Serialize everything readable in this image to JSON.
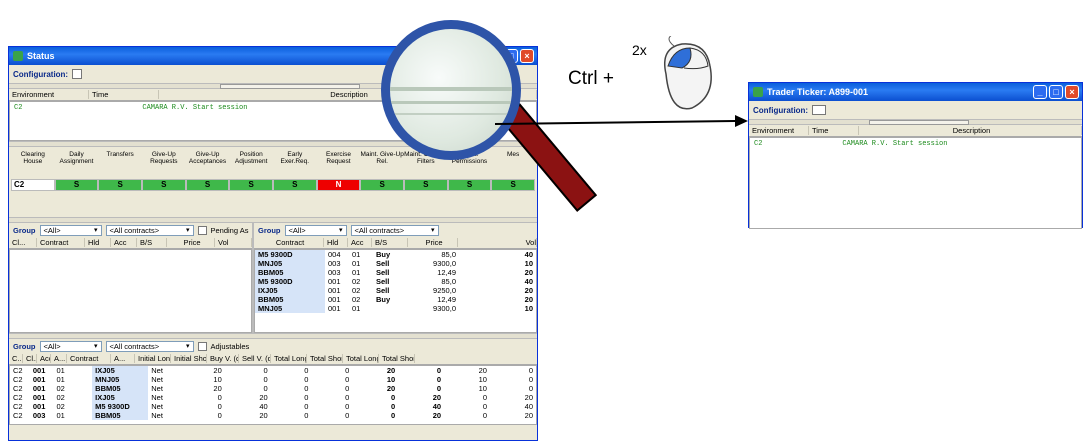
{
  "status_window": {
    "title": "Status",
    "config_label": "Configuration:",
    "log_headers": [
      "Environment",
      "Time",
      "Description"
    ],
    "log_rows": [
      {
        "env": "C2",
        "text": "CAMARA R.V. Start session"
      }
    ],
    "status_headers": [
      "Clearing House",
      "Daily Assignment",
      "Transfers",
      "Give-Up Requests",
      "Give-Up Acceptances",
      "Position Adjustment",
      "Early Exer.Req.",
      "Exercise Request",
      "Maint. Give-Up Rel.",
      "Maint. Give-Up Filters",
      "Maint. Permissions",
      "Mes"
    ],
    "status_row": {
      "house": "C2",
      "values": [
        "S",
        "S",
        "S",
        "S",
        "S",
        "S",
        "N",
        "S",
        "S",
        "S",
        "S"
      ]
    },
    "group_bar_left": {
      "group_label": "Group",
      "group_val": "<All>",
      "contracts_val": "<All contracts>",
      "pending_label": "Pending As"
    },
    "group_bar_right": {
      "group_label": "Group",
      "group_val": "<All>",
      "contracts_val": "<All contracts>"
    },
    "left_pos_headers": [
      "Cl...",
      "Contract",
      "Hld",
      "Acc",
      "B/S",
      "Price",
      "Vol"
    ],
    "right_pos_headers": [
      "Contract",
      "Hld",
      "Acc",
      "B/S",
      "Price",
      "Vol"
    ],
    "right_pos_rows": [
      [
        "M5 9300D",
        "004",
        "01",
        "Buy",
        "85,0",
        "40"
      ],
      [
        "MNJ05",
        "003",
        "01",
        "Sell",
        "9300,0",
        "10"
      ],
      [
        "BBM05",
        "003",
        "01",
        "Sell",
        "12,49",
        "20"
      ],
      [
        "M5 9300D",
        "001",
        "02",
        "Sell",
        "85,0",
        "40"
      ],
      [
        "IXJ05",
        "001",
        "02",
        "Sell",
        "9250,0",
        "20"
      ],
      [
        "BBM05",
        "001",
        "02",
        "Buy",
        "12,49",
        "20"
      ],
      [
        "MNJ05",
        "001",
        "01",
        "",
        "9300,0",
        "10"
      ]
    ],
    "group_bar_bottom": {
      "group_label": "Group",
      "group_val": "<All>",
      "contracts_val": "<All contracts>",
      "adjustable_label": "Adjustables"
    },
    "bottom_headers": [
      "C..",
      "Cl..",
      "Acc",
      "A...",
      "Contract",
      "A...",
      "Initial Long",
      "Initial Short",
      "Buy V. (d)",
      "Sell V. (d)",
      "Total Long...",
      "Total Short...",
      "Total Long...",
      "Total Short..."
    ],
    "bottom_rows": [
      [
        "C2",
        "001",
        "01",
        "",
        "IXJ05",
        "Net",
        "20",
        "0",
        "0",
        "0",
        "20",
        "0",
        "20",
        "0"
      ],
      [
        "C2",
        "001",
        "01",
        "",
        "MNJ05",
        "Net",
        "10",
        "0",
        "0",
        "0",
        "10",
        "0",
        "10",
        "0"
      ],
      [
        "C2",
        "001",
        "02",
        "",
        "BBM05",
        "Net",
        "20",
        "0",
        "0",
        "0",
        "20",
        "0",
        "10",
        "0"
      ],
      [
        "C2",
        "001",
        "02",
        "",
        "IXJ05",
        "Net",
        "0",
        "20",
        "0",
        "0",
        "0",
        "20",
        "0",
        "20"
      ],
      [
        "C2",
        "001",
        "02",
        "",
        "M5 9300D",
        "Net",
        "0",
        "40",
        "0",
        "0",
        "0",
        "40",
        "0",
        "40"
      ],
      [
        "C2",
        "003",
        "01",
        "",
        "BBM05",
        "Net",
        "0",
        "20",
        "0",
        "0",
        "0",
        "20",
        "0",
        "20"
      ]
    ]
  },
  "annotation": {
    "shortcut": "Ctrl +",
    "clicks": "2x"
  },
  "ticker_window": {
    "title": "Trader Ticker: A899-001",
    "config_label": "Configuration:",
    "headers": [
      "Environment",
      "Time",
      "Description"
    ],
    "rows": [
      {
        "env": "C2",
        "text": "CAMARA R.V. Start session"
      }
    ]
  },
  "colors": {
    "ok": "#3fb84a",
    "fail": "#e00000",
    "title": "#0a5fdc"
  }
}
